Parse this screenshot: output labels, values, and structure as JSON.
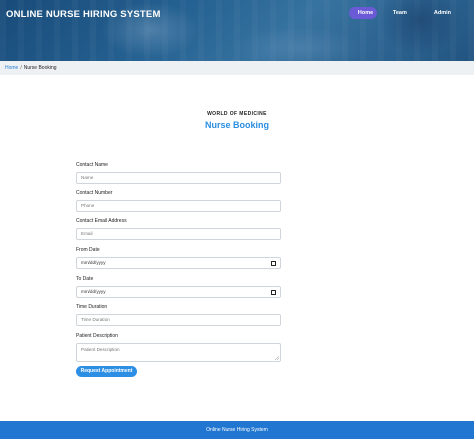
{
  "header": {
    "brand": "ONLINE NURSE HIRING SYSTEM",
    "nav": [
      {
        "label": "Home",
        "active": true
      },
      {
        "label": "Team",
        "active": false
      },
      {
        "label": "Admin",
        "active": false
      }
    ]
  },
  "breadcrumb": {
    "home": "Home",
    "separator": "/",
    "current": "Nurse Booking"
  },
  "section": {
    "kicker": "WORLD OF MEDICINE",
    "title": "Nurse Booking"
  },
  "form": {
    "fields": [
      {
        "label": "Contact Name",
        "placeholder": "Name"
      },
      {
        "label": "Contact Number",
        "placeholder": "Phone"
      },
      {
        "label": "Contact Email Address",
        "placeholder": "Email"
      },
      {
        "label": "From Date",
        "placeholder": "mm/dd/yyyy"
      },
      {
        "label": "To Date",
        "placeholder": "mm/dd/yyyy"
      },
      {
        "label": "Time Duration",
        "placeholder": "Time Duration"
      },
      {
        "label": "Patient Description",
        "placeholder": "Patient Description"
      }
    ],
    "submit_label": "Request Appointment"
  },
  "footer": {
    "text": "Online Nurse Hiring System"
  },
  "colors": {
    "accent": "#2d8fe4",
    "nav_active": "#6b5ad6",
    "footer": "#2076d0"
  }
}
